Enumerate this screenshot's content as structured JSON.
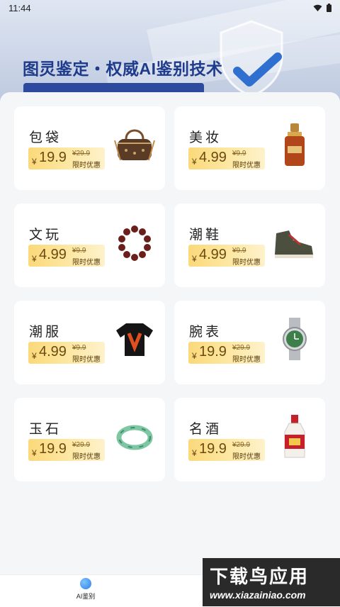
{
  "status_bar": {
    "time": "11:44"
  },
  "hero": {
    "title": "图灵鉴定・权威AI鉴别技术"
  },
  "categories": [
    {
      "name": "包袋",
      "price": "19.9",
      "original": "¥29.9",
      "tag": "限时优惠",
      "icon": "handbag-icon"
    },
    {
      "name": "美妆",
      "price": "4.99",
      "original": "¥9.9",
      "tag": "限时优惠",
      "icon": "serum-bottle-icon"
    },
    {
      "name": "文玩",
      "price": "4.99",
      "original": "¥9.9",
      "tag": "限时优惠",
      "icon": "bead-bracelet-icon"
    },
    {
      "name": "潮鞋",
      "price": "4.99",
      "original": "¥9.9",
      "tag": "限时优惠",
      "icon": "sneaker-icon"
    },
    {
      "name": "潮服",
      "price": "4.99",
      "original": "¥9.9",
      "tag": "限时优惠",
      "icon": "tshirt-icon"
    },
    {
      "name": "腕表",
      "price": "19.9",
      "original": "¥29.9",
      "tag": "限时优惠",
      "icon": "watch-icon"
    },
    {
      "name": "玉石",
      "price": "19.9",
      "original": "¥29.9",
      "tag": "限时优惠",
      "icon": "jade-bangle-icon"
    },
    {
      "name": "名酒",
      "price": "19.9",
      "original": "¥29.9",
      "tag": "限时优惠",
      "icon": "liquor-bottle-icon"
    }
  ],
  "currency_symbol": "¥",
  "bottom_nav": {
    "items": [
      {
        "label": "AI鉴别",
        "icon": "ai-appraisal-icon"
      }
    ]
  },
  "watermark": {
    "title": "下载鸟应用",
    "url": "www.xiazainiao.com"
  }
}
